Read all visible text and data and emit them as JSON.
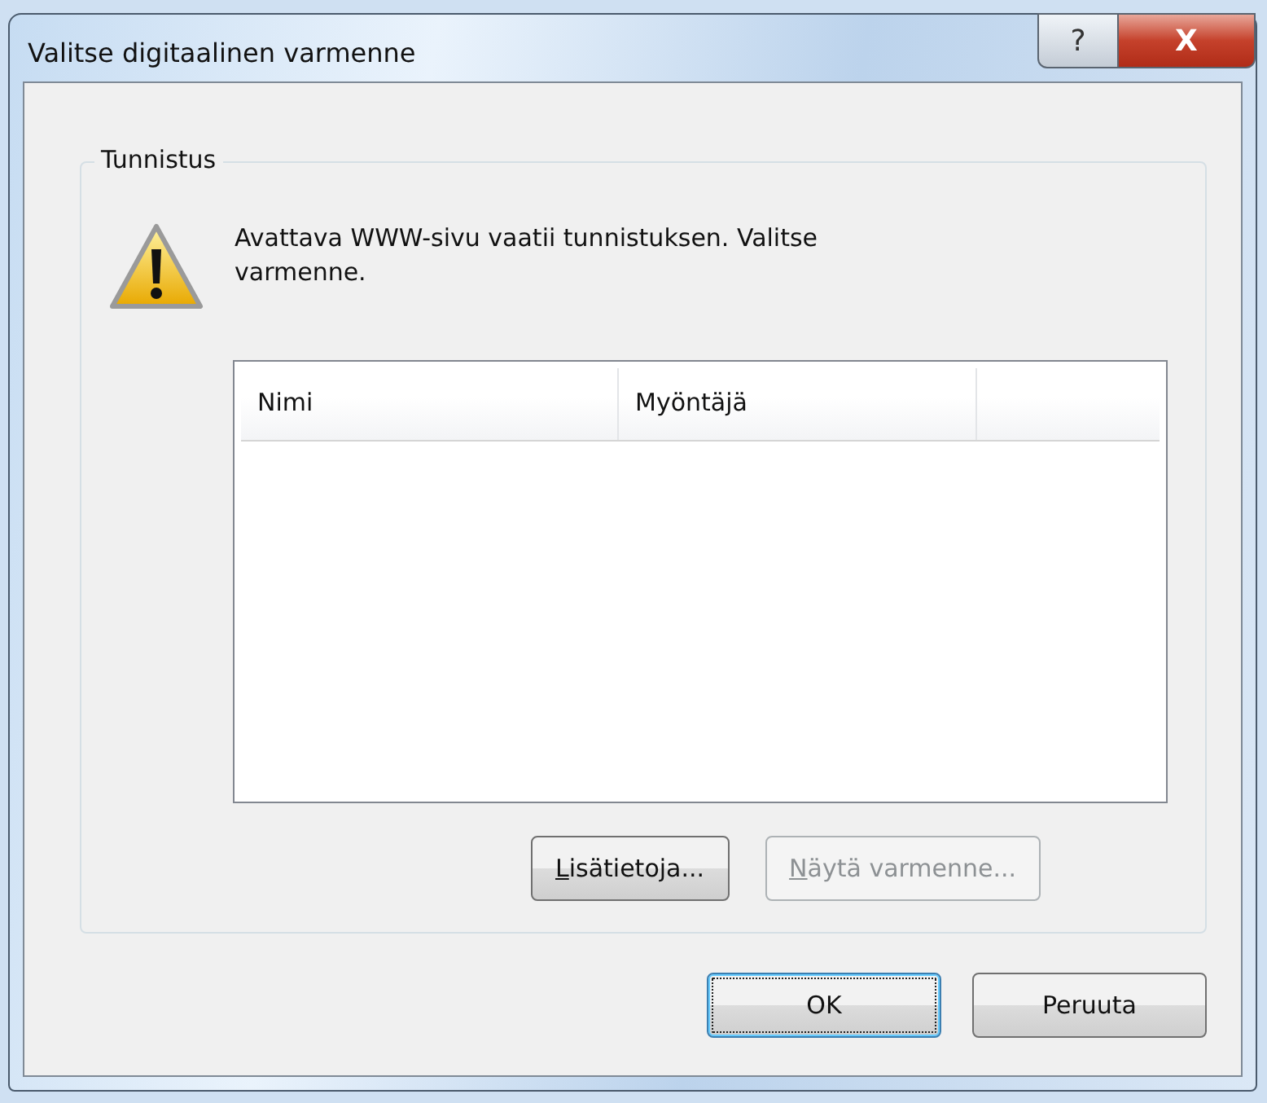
{
  "window": {
    "title": "Valitse digitaalinen varmenne",
    "controls": [
      {
        "kind": "help",
        "label": "?"
      },
      {
        "kind": "close",
        "label": "X"
      }
    ]
  },
  "group": {
    "label": "Tunnistus",
    "message": "Avattava WWW-sivu vaatii tunnistuksen. Valitse varmenne."
  },
  "table": {
    "columns": [
      "Nimi",
      "Myöntäjä"
    ]
  },
  "list_buttons": [
    {
      "access_key": "L",
      "rest": "isätietoja...",
      "disabled": false
    },
    {
      "access_key": "N",
      "rest": "äytä varmenne...",
      "disabled": true
    }
  ],
  "buttons": [
    {
      "label": "OK",
      "focused": true
    },
    {
      "label": "Peruuta",
      "focused": false
    }
  ]
}
